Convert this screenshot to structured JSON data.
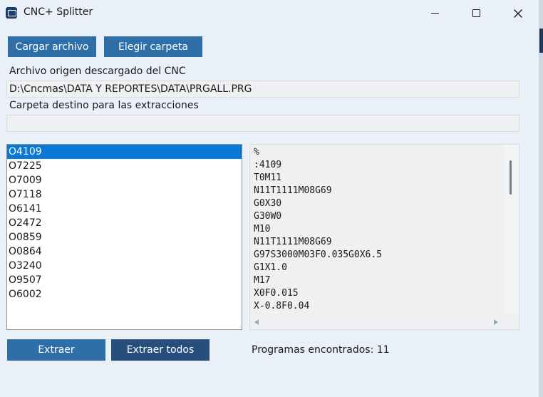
{
  "window": {
    "title": "CNC+ Splitter",
    "icons": [
      "app-icon",
      "minimize-icon",
      "maximize-icon",
      "close-icon"
    ]
  },
  "toolbar": {
    "load_file_label": "Cargar archivo",
    "choose_folder_label": "Elegir carpeta"
  },
  "source": {
    "label": "Archivo origen descargado del CNC",
    "value": "D:\\Cncmas\\DATA Y REPORTES\\DATA\\PRGALL.PRG"
  },
  "destination": {
    "label": "Carpeta destino para las extracciones",
    "value": ""
  },
  "programs": {
    "selected": "O4109",
    "items": [
      "O4109",
      "O7225",
      "O7009",
      "O7118",
      "O6141",
      "O2472",
      "O0859",
      "O0864",
      "O3240",
      "O9507",
      "O6002"
    ]
  },
  "code": {
    "lines": [
      "%",
      ":4109",
      "T0M11",
      "N11T1111M08G69",
      "G0X30",
      "G30W0",
      "M10",
      "N11T1111M08G69",
      "G97S3000M03F0.035G0X6.5",
      "G1X1.0",
      "M17",
      "X0F0.015",
      "X-0.8F0.04"
    ]
  },
  "actions": {
    "extract_label": "Extraer",
    "extract_all_label": "Extraer todos"
  },
  "status": {
    "text": "Programas encontrados: 11"
  },
  "colors": {
    "selection": "#0a78d7",
    "button_primary": "#2e6fa7",
    "button_dark": "#274f7c",
    "window_bg": "#e9f0f8"
  }
}
